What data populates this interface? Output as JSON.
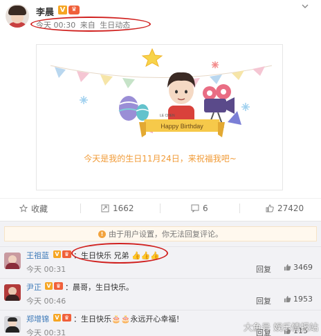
{
  "post": {
    "author": "李晨",
    "time": "今天 00:30",
    "source_prefix": "来自",
    "source": "生日动态",
    "card_text": "今天是我的生日11月24日，来祝福我吧~",
    "banner_text": "Happy Birthday",
    "signature": "LE CHEN"
  },
  "actions": {
    "favorite": "收藏",
    "repost": "1662",
    "comment": "6",
    "like": "27420"
  },
  "notice": "由于用户设置，你无法回复评论。",
  "comments": [
    {
      "name": "王祖蓝",
      "text": "：生日快乐 兄弟",
      "time": "今天 00:31",
      "reply": "回复",
      "likes": "3469"
    },
    {
      "name": "尹正",
      "text": "：晨哥，生日快乐。",
      "time": "今天 00:46",
      "reply": "回复",
      "likes": "1953"
    },
    {
      "name": "郑增锦",
      "text": "：生日快乐",
      "text2": "永远开心幸福！",
      "time": "今天 00:31",
      "reply": "回复",
      "likes": "115"
    }
  ],
  "watermark": "大鱼号 娱乐情报站",
  "colors": {
    "accent_orange": "#f19b37",
    "link_blue": "#3c79b8",
    "highlight_red": "#d0201e"
  },
  "icons": [
    "more-icon",
    "star-icon",
    "repost-icon",
    "comment-icon",
    "like-icon",
    "info-icon",
    "thumb-icon"
  ]
}
